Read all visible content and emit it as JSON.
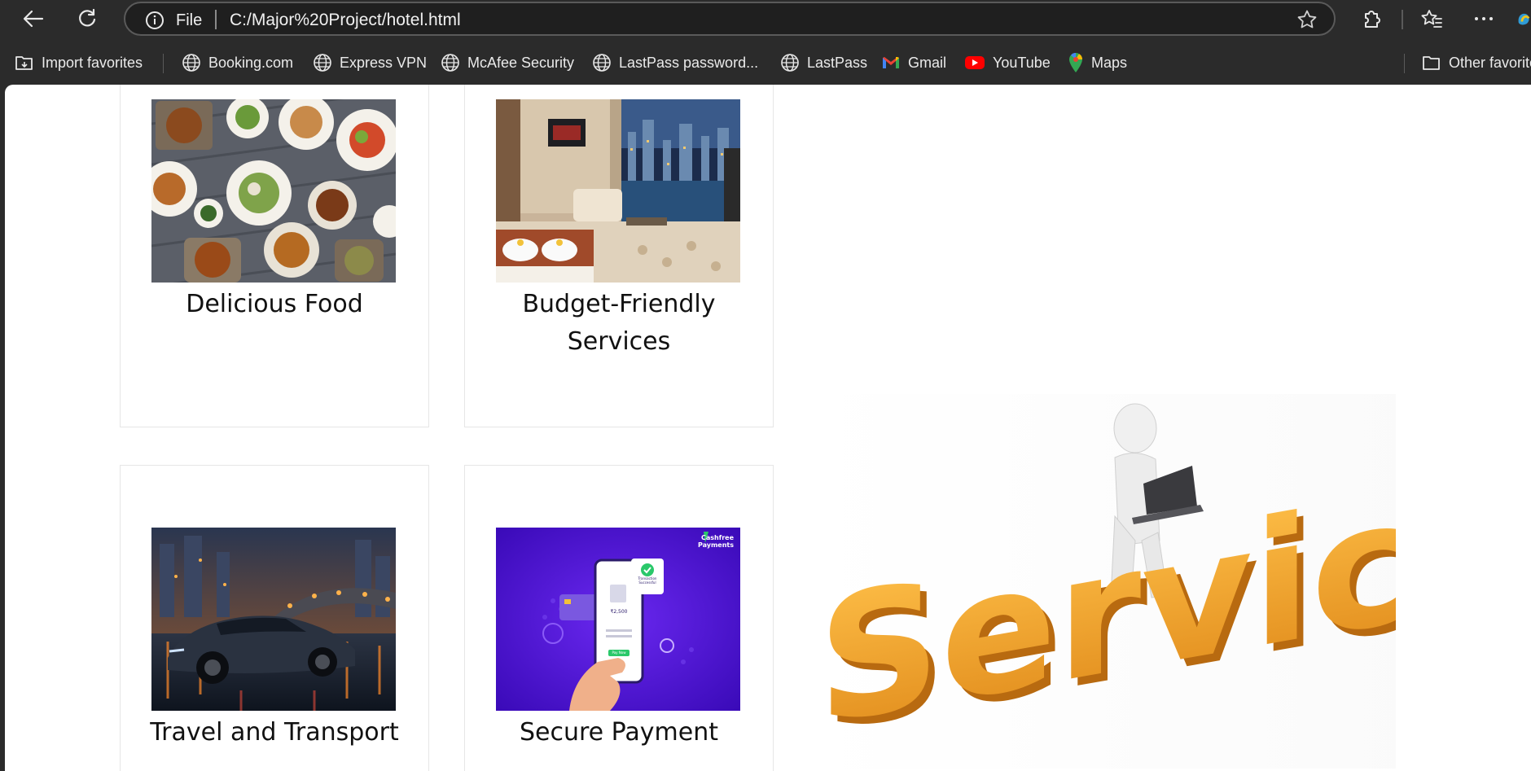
{
  "browser": {
    "page_info_label": "File",
    "url": "C:/Major%20Project/hotel.html"
  },
  "favorites": {
    "items": [
      {
        "label": "Import favorites",
        "icon": "import-folder-icon"
      },
      {
        "label": "Booking.com",
        "icon": "globe-icon"
      },
      {
        "label": "Express VPN",
        "icon": "globe-icon"
      },
      {
        "label": "McAfee Security",
        "icon": "globe-icon"
      },
      {
        "label": "LastPass password...",
        "icon": "globe-icon"
      },
      {
        "label": "LastPass",
        "icon": "globe-icon"
      },
      {
        "label": "Gmail",
        "icon": "gmail-icon"
      },
      {
        "label": "YouTube",
        "icon": "youtube-icon"
      },
      {
        "label": "Maps",
        "icon": "maps-icon"
      }
    ],
    "other": "Other favorites"
  },
  "services": {
    "cards": [
      {
        "title": "Delicious Food"
      },
      {
        "title": "Budget-Friendly Services"
      },
      {
        "title": "Travel and Transport"
      },
      {
        "title": "Secure Payment"
      }
    ],
    "hero_text": "Service",
    "payment_image": {
      "brand": "Cashfree Payments",
      "status": "Transaction Successful",
      "amount": "₹2,500",
      "button": "Pay Now"
    }
  },
  "colors": {
    "chrome_bg": "#2b2b2b",
    "hero_orange": "#f3a434",
    "payment_purple": "#4b10d8"
  }
}
